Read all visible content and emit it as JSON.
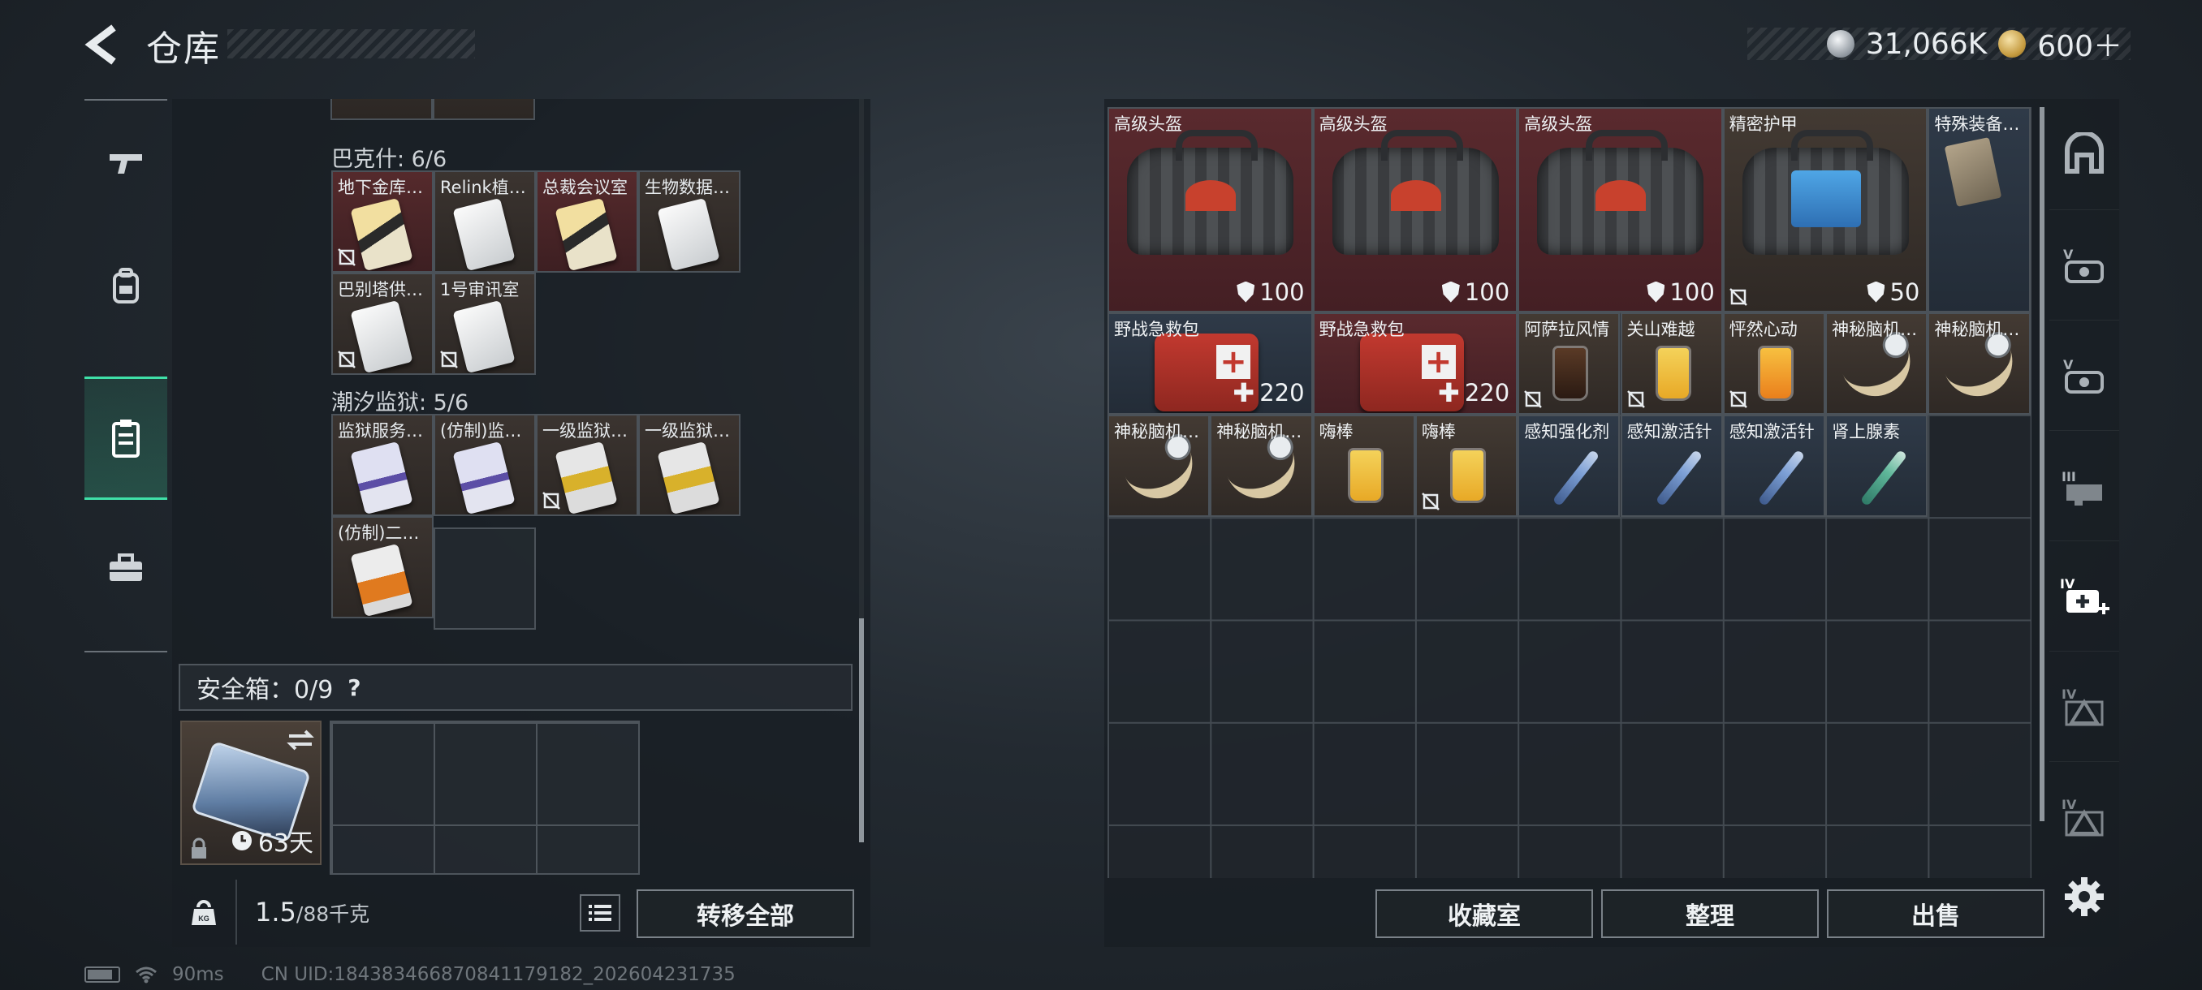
{
  "header": {
    "title": "仓库"
  },
  "currency": {
    "silver": "31,066K",
    "gold": "600＋"
  },
  "left_nav": [
    "weapon-tab",
    "gear-tab",
    "storage-tab",
    "case-tab"
  ],
  "groups": [
    {
      "label": "巴克什: 6/6",
      "items": [
        {
          "name": "地下金库…",
          "art": "gold",
          "tint": "red",
          "nobind": true
        },
        {
          "name": "Relink植…",
          "art": "white",
          "tint": "brown",
          "nobind": false
        },
        {
          "name": "总裁会议室",
          "art": "gold",
          "tint": "red",
          "nobind": false
        },
        {
          "name": "生物数据…",
          "art": "white",
          "tint": "brown",
          "nobind": false
        },
        {
          "name": "巴别塔供…",
          "art": "white",
          "tint": "brown",
          "nobind": true
        },
        {
          "name": "1号审讯室",
          "art": "white",
          "tint": "brown",
          "nobind": true
        }
      ]
    },
    {
      "label": "潮汐监狱: 5/6",
      "items": [
        {
          "name": "监狱服务…",
          "art": "purple",
          "tint": "brown",
          "nobind": false
        },
        {
          "name": "(仿制)监…",
          "art": "purple",
          "tint": "brown",
          "nobind": false
        },
        {
          "name": "一级监狱…",
          "art": "yellow",
          "tint": "brown",
          "nobind": true
        },
        {
          "name": "一级监狱…",
          "art": "yellow",
          "tint": "brown",
          "nobind": false
        },
        {
          "name": "(仿制)二…",
          "art": "orange",
          "tint": "brown",
          "nobind": false
        }
      ]
    }
  ],
  "safe_box": {
    "label": "安全箱：0/9",
    "help": "?",
    "days": "63天"
  },
  "weight": {
    "current": "1.5",
    "max": "/88千克"
  },
  "buttons": {
    "transfer_all": "转移全部",
    "collection": "收藏室",
    "sort": "整理",
    "sell": "出售"
  },
  "stash_items": [
    {
      "name": "高级头盔",
      "bg": "red",
      "art": "bag",
      "stat": "100",
      "stat_icon": "shield",
      "nobind": false
    },
    {
      "name": "高级头盔",
      "bg": "red",
      "art": "bag",
      "stat": "100",
      "stat_icon": "shield",
      "nobind": false
    },
    {
      "name": "高级头盔",
      "bg": "red",
      "art": "bag",
      "stat": "100",
      "stat_icon": "shield",
      "nobind": false
    },
    {
      "name": "精密护甲",
      "bg": "brown",
      "art": "bag-blue",
      "stat": "50",
      "stat_icon": "shield",
      "nobind": true
    },
    {
      "name": "特殊装备…",
      "bg": "blue",
      "art": "case",
      "stat": "",
      "stat_icon": "",
      "nobind": false
    },
    {
      "name": "野战急救包",
      "bg": "blue",
      "art": "medkit",
      "stat": "220",
      "stat_icon": "plus",
      "nobind": false
    },
    {
      "name": "野战急救包",
      "bg": "red",
      "art": "medkit",
      "stat": "220",
      "stat_icon": "plus",
      "nobind": false
    },
    {
      "name": "阿萨拉风情",
      "bg": "brown",
      "art": "drink-dark",
      "stat": "",
      "stat_icon": "",
      "nobind": true
    },
    {
      "name": "关山难越",
      "bg": "brown",
      "art": "drink",
      "stat": "",
      "stat_icon": "",
      "nobind": true
    },
    {
      "name": "怦然心动",
      "bg": "brown",
      "art": "drink-orange",
      "stat": "",
      "stat_icon": "",
      "nobind": true
    },
    {
      "name": "神秘脑机…",
      "bg": "brown",
      "art": "brain",
      "stat": "",
      "stat_icon": "",
      "nobind": false
    },
    {
      "name": "神秘脑机…",
      "bg": "brown",
      "art": "brain",
      "stat": "",
      "stat_icon": "",
      "nobind": false
    },
    {
      "name": "神秘脑机…",
      "bg": "brown",
      "art": "brain",
      "stat": "",
      "stat_icon": "",
      "nobind": false
    },
    {
      "name": "神秘脑机…",
      "bg": "brown",
      "art": "brain",
      "stat": "",
      "stat_icon": "",
      "nobind": false
    },
    {
      "name": "嗨棒",
      "bg": "brown",
      "art": "drink",
      "stat": "",
      "stat_icon": "",
      "nobind": false
    },
    {
      "name": "嗨棒",
      "bg": "brown",
      "art": "drink",
      "stat": "",
      "stat_icon": "",
      "nobind": true
    },
    {
      "name": "感知强化剂",
      "bg": "blue",
      "art": "syringe",
      "stat": "",
      "stat_icon": "",
      "nobind": false
    },
    {
      "name": "感知激活针",
      "bg": "blue",
      "art": "syringe",
      "stat": "",
      "stat_icon": "",
      "nobind": false
    },
    {
      "name": "感知激活针",
      "bg": "blue",
      "art": "syringe",
      "stat": "",
      "stat_icon": "",
      "nobind": false
    },
    {
      "name": "肾上腺素",
      "bg": "blue",
      "art": "syringe-green",
      "stat": "",
      "stat_icon": "",
      "nobind": false
    }
  ],
  "right_nav": [
    "overview-icon",
    "V",
    "V",
    "III",
    "IV",
    "IV",
    "IV"
  ],
  "status": {
    "ping": "90ms",
    "uid": "CN UID:18438346687084117918​2_202604231735"
  },
  "colors": {
    "accent": "#3fe0a8",
    "red_tier": "#552a2c",
    "blue_tier": "#2f3a48",
    "brown_tier": "#3b3430"
  }
}
